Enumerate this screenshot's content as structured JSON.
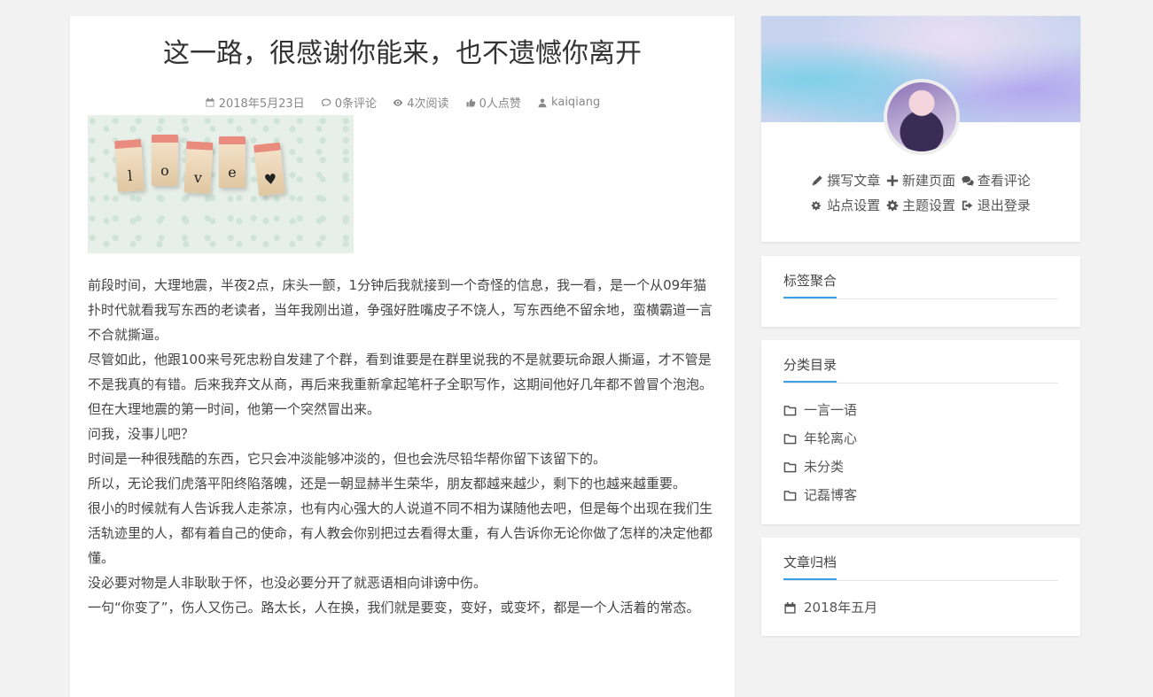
{
  "article": {
    "title": "这一路，很感谢你能来，也不遗憾你离开",
    "meta": {
      "date": "2018年5月23日",
      "comments": "0条评论",
      "views": "4次阅读",
      "likes": "0人点赞",
      "author": "kaiqiang"
    },
    "image_text": "love",
    "paragraphs": [
      "前段时间，大理地震，半夜2点，床头一颤，1分钟后我就接到一个奇怪的信息，我一看，是一个从09年猫扑时代就看我写东西的老读者，当年我刚出道，争强好胜嘴皮子不饶人，写东西绝不留余地，蛮横霸道一言不合就撕逼。",
      "尽管如此，他跟100来号死忠粉自发建了个群，看到谁要是在群里说我的不是就要玩命跟人撕逼，才不管是不是我真的有错。后来我弃文从商，再后来我重新拿起笔杆子全职写作，这期间他好几年都不曾冒个泡泡。",
      "但在大理地震的第一时间，他第一个突然冒出来。",
      "问我，没事儿吧？",
      "时间是一种很残酷的东西，它只会冲淡能够冲淡的，但也会洗尽铅华帮你留下该留下的。",
      "所以，无论我们虎落平阳终陷落魄，还是一朝显赫半生荣华，朋友都越来越少，剩下的也越来越重要。",
      "很小的时候就有人告诉我人走茶凉，也有内心强大的人说道不同不相为谋随他去吧，但是每个出现在我们生活轨迹里的人，都有着自己的使命，有人教会你别把过去看得太重，有人告诉你无论你做了怎样的决定他都懂。",
      "没必要对物是人非耿耿于怀，也没必要分开了就恶语相向诽谤中伤。",
      "一句“你变了”，伤人又伤己。路太长，人在换，我们就是要变，变好，或变坏，都是一个人活着的常态。"
    ]
  },
  "sidebar": {
    "admin_links": [
      {
        "label": "撰写文章",
        "icon": "pencil-icon"
      },
      {
        "label": "新建页面",
        "icon": "plus-icon"
      },
      {
        "label": "查看评论",
        "icon": "comments-icon"
      },
      {
        "label": "站点设置",
        "icon": "cogs-icon"
      },
      {
        "label": "主题设置",
        "icon": "gear-icon"
      },
      {
        "label": "退出登录",
        "icon": "sign-out-icon"
      }
    ],
    "tags_widget": {
      "title": "标签聚合"
    },
    "categories_widget": {
      "title": "分类目录",
      "items": [
        "一言一语",
        "年轮离心",
        "未分类",
        "记磊博客"
      ]
    },
    "archive_widget": {
      "title": "文章归档",
      "items": [
        "2018年五月"
      ]
    }
  },
  "colors": {
    "accent": "#3aa0e8",
    "background": "#f2f2f2"
  }
}
